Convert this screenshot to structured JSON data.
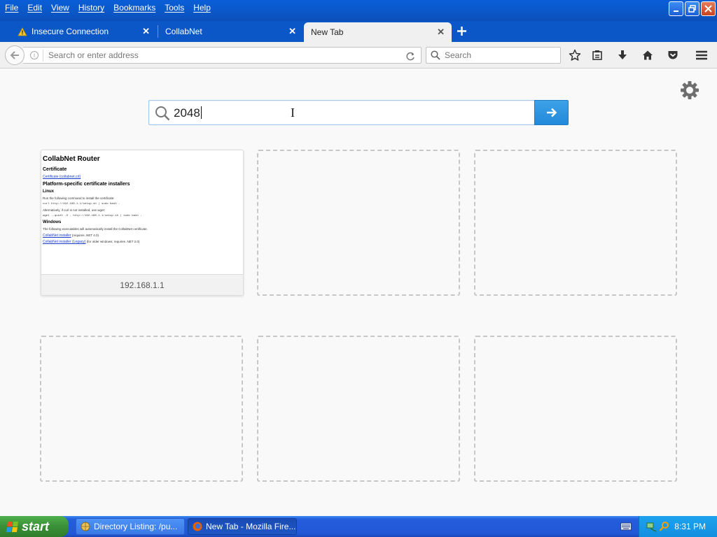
{
  "menu": [
    "File",
    "Edit",
    "View",
    "History",
    "Bookmarks",
    "Tools",
    "Help"
  ],
  "tabs": [
    {
      "label": "Insecure Connection",
      "icon": "warning-icon"
    },
    {
      "label": "CollabNet"
    },
    {
      "label": "New Tab",
      "active": true
    }
  ],
  "navbar": {
    "url_placeholder": "Search or enter address",
    "search_placeholder": "Search"
  },
  "newtab": {
    "search_value": "2048"
  },
  "tiles": [
    {
      "caption": "192.168.1.1",
      "thumbnail": {
        "title": "CollabNet Router",
        "certificate_heading": "Certificate",
        "certificate_link": "Certificate (collabnet.crt)",
        "installers_heading": "Platform-specific certificate installers",
        "linux_heading": "Linux",
        "linux_text1": "Run the following command to install the certificate:",
        "linux_code1": "curl http://192.168.1.1/setup.sh | sudo bash -",
        "linux_text2": "Alternatively, if curl is not installed, use wget:",
        "linux_code2": "wget --quiet -O - http://192.168.1.1/setup.sh | sudo bash -",
        "windows_heading": "Windows",
        "windows_text": "The following executables will automatically install the CollabNet certificate.",
        "windows_link1": "CollabNet installer",
        "windows_link1_note": "(requires .NET 4.0)",
        "windows_link2": "CollabNet installer (Legacy)",
        "windows_link2_note": "(for older windows; requires .NET 2.0)"
      }
    }
  ],
  "taskbar": {
    "start_label": "start",
    "items": [
      {
        "label": "Directory Listing: /pu..."
      },
      {
        "label": "New Tab - Mozilla Fire...",
        "active": true
      }
    ],
    "clock": "8:31 PM"
  },
  "colors": {
    "titlebar": "#0b57c8",
    "go_button": "#2a90df",
    "start_green": "#3a8f37"
  }
}
